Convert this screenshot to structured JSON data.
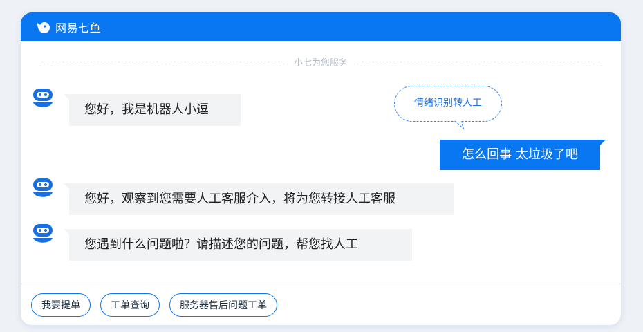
{
  "app": {
    "title": "网易七鱼"
  },
  "divider": {
    "text": "小七为您服务"
  },
  "messages": [
    {
      "text": "您好，我是机器人小逗"
    },
    {
      "text": "怎么回事 太垃圾了吧"
    },
    {
      "text": "您好，观察到您需要人工客服介入，将为您转接人工客服"
    },
    {
      "text": "您遇到什么问题啦？请描述您的问题，帮您找人工"
    }
  ],
  "emotion_tag": {
    "text": "情绪识别转人工"
  },
  "quick_actions": [
    {
      "label": "我要提单"
    },
    {
      "label": "工单查询"
    },
    {
      "label": "服务器售后问题工单"
    }
  ],
  "colors": {
    "brand": "#0a77f2",
    "bot_bubble": "#f2f3f5",
    "avatar": "#1a6fe0"
  },
  "icons": {
    "logo": "bird-logo-icon",
    "avatar": "robot-avatar-icon"
  }
}
